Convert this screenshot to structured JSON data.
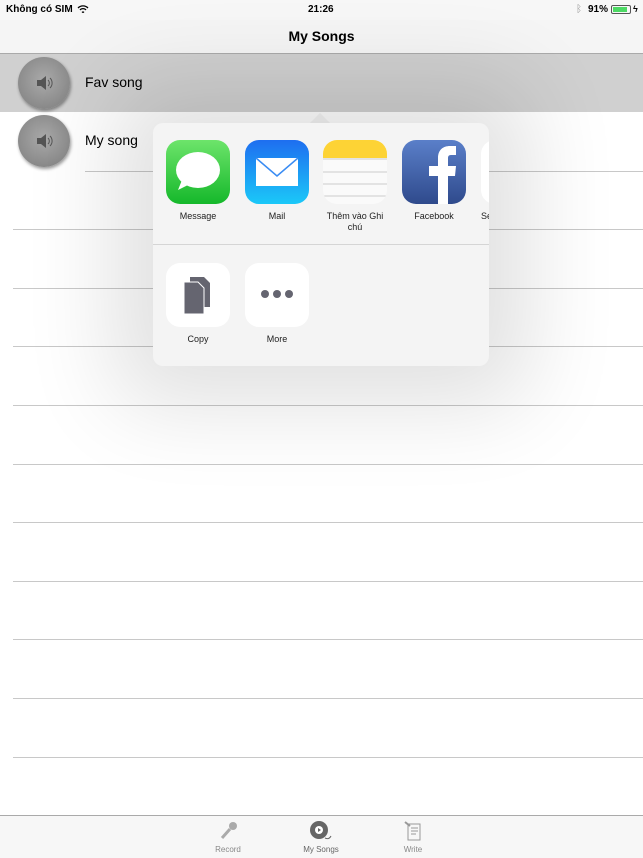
{
  "status": {
    "carrier": "Không có SIM",
    "time": "21:26",
    "battery": "91%"
  },
  "nav": {
    "title": "My Songs"
  },
  "songs": [
    {
      "title": "Fav song",
      "selected": true
    },
    {
      "title": "My song",
      "selected": false
    }
  ],
  "share": {
    "apps": [
      {
        "label": "Message",
        "icon": "message-icon"
      },
      {
        "label": "Mail",
        "icon": "mail-icon"
      },
      {
        "label": "Thêm vào Ghi chú",
        "icon": "notes-icon"
      },
      {
        "label": "Facebook",
        "icon": "facebook-icon"
      },
      {
        "label": "Se",
        "icon": "partial-app-icon"
      }
    ],
    "actions": [
      {
        "label": "Copy",
        "icon": "copy-icon"
      },
      {
        "label": "More",
        "icon": "more-icon"
      }
    ]
  },
  "tabbar": {
    "items": [
      {
        "label": "Record",
        "icon": "microphone-icon"
      },
      {
        "label": "My Songs",
        "icon": "film-reel-icon"
      },
      {
        "label": "Write",
        "icon": "notepad-icon"
      }
    ],
    "active": "My Songs"
  },
  "colors": {
    "selected_row": "#d0d0d0",
    "battery": "#4cd964",
    "facebook": "#3b5998"
  }
}
